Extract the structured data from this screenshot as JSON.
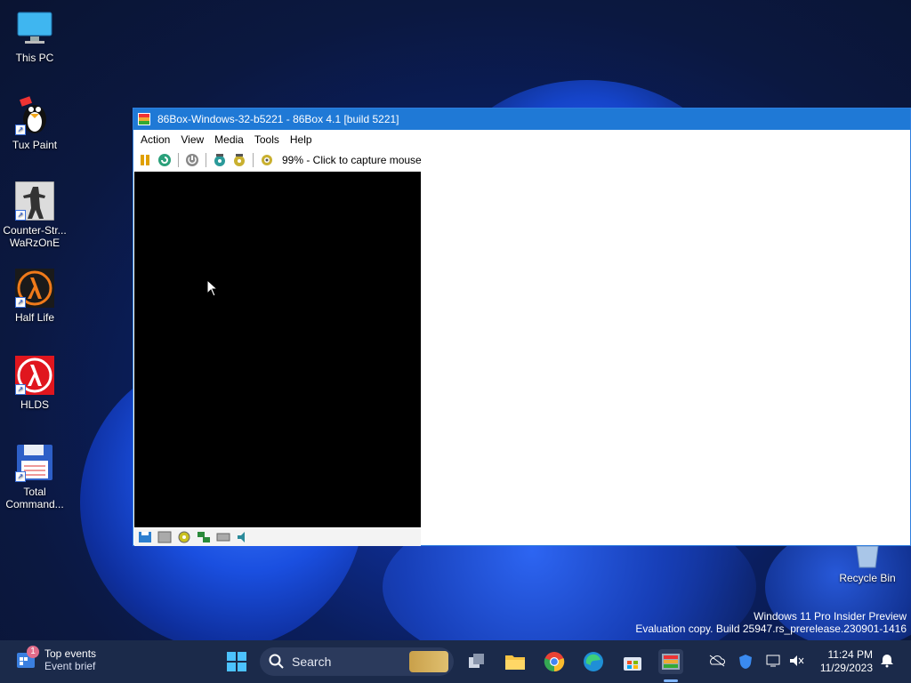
{
  "desktop": {
    "icons": [
      {
        "label": "This PC",
        "icon": "monitor-icon"
      },
      {
        "label": "Tux Paint",
        "icon": "penguin-icon"
      },
      {
        "label": "Counter-Str... WaRzOnE",
        "icon": "soldier-icon"
      },
      {
        "label": "Half Life",
        "icon": "lambda-icon"
      },
      {
        "label": "HLDS",
        "icon": "lambda-red-icon"
      },
      {
        "label": "Total Command...",
        "icon": "floppy-icon"
      }
    ],
    "recycle_bin": "Recycle Bin"
  },
  "window": {
    "title": "86Box-Windows-32-b5221 - 86Box 4.1 [build 5221]",
    "menu": [
      "Action",
      "View",
      "Media",
      "Tools",
      "Help"
    ],
    "status_text": "99% - Click to capture mouse",
    "toolbar_icons": [
      "pause-icon",
      "reset-icon",
      "power-icon",
      "settings-icon",
      "ctrl-alt-del-icon",
      "screenshot-icon"
    ],
    "statusbar_icons": [
      "floppy-icon",
      "cdrom-icon",
      "disc-icon",
      "network-icon",
      "hdd-icon",
      "sound-icon"
    ]
  },
  "watermark": {
    "line1": "Windows 11 Pro Insider Preview",
    "line2": "Evaluation copy. Build 25947.rs_prerelease.230901-1416"
  },
  "taskbar": {
    "widget_title": "Top events",
    "widget_sub": "Event brief",
    "widget_badge": "1",
    "search_placeholder": "Search",
    "time": "11:24 PM",
    "date": "11/29/2023"
  }
}
